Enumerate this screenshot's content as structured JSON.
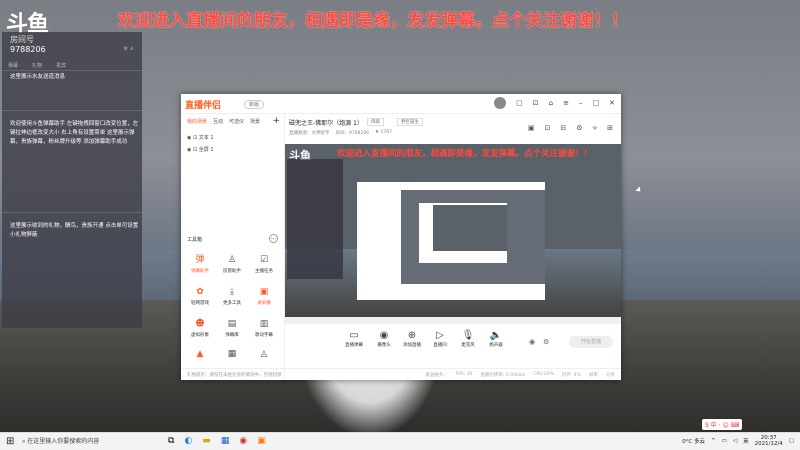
{
  "overlay": {
    "logo": "斗鱼",
    "marquee": "欢迎进入直播间的朋友，相遇即是缘，发发弹幕。点个关注谢谢！！"
  },
  "left_panel": {
    "room_label": "房间号",
    "room_id": "9788206",
    "tab_labels": [
      "弹幕",
      "礼物",
      "贵宾"
    ],
    "notice_1": "这里展示水友送道消息",
    "notice_2": "欢迎使用斗鱼弹幕助手 左键拖拽回窗口改变位置，左键拉伸边框改变大小 右上角有设置菜单 这里展示弹幕，贵族弹幕，粉丝牌升级等 添加弹幕助手成功",
    "notice_3": "这里展示收到的礼物，酬鸟，贵族开通 点击单可设置小礼物屏蔽"
  },
  "app": {
    "name": "直播伴侣",
    "version": "新版",
    "sidebar": {
      "tabs": [
        "我的场景",
        "互动",
        "可选仪",
        "场景"
      ],
      "add_label": "+",
      "items": [
        "文本 1",
        "全屏 1"
      ],
      "tools_title": "工具箱",
      "tools": [
        {
          "label": "弹幕助手",
          "icon": "弹"
        },
        {
          "label": "房管助手",
          "icon": "♙"
        },
        {
          "label": "主播任务",
          "icon": "☑"
        },
        {
          "label": "轻网游戏",
          "icon": "✿"
        },
        {
          "label": "更多工具",
          "icon": "⤓"
        },
        {
          "label": "录屏播",
          "icon": "▣"
        },
        {
          "label": "虚拟形象",
          "icon": "☻"
        },
        {
          "label": "弹幕库",
          "icon": "▤"
        },
        {
          "label": "歌词字幕",
          "icon": "▥"
        },
        {
          "label": "",
          "icon": "▲"
        },
        {
          "label": "",
          "icon": "▦"
        },
        {
          "label": "",
          "icon": "◬"
        }
      ]
    },
    "room": {
      "title": "磁兜之王-佛耶尔（炮源 1）",
      "chip_1": "佛耶",
      "chip_2": "野巨篇生",
      "sub": [
        "直播频道：大神捉字",
        "房间：9788206",
        "♦ 1797"
      ]
    },
    "preview": {
      "logo": "斗鱼",
      "marquee": "欢迎进入直播间的朋友，相遇即是缘，发发弹幕。点个关注谢谢！！"
    },
    "controls": [
      {
        "label": "直播弹幕",
        "icon": "▭"
      },
      {
        "label": "摄像头",
        "icon": "◉"
      },
      {
        "label": "添加直播",
        "icon": "⊕"
      },
      {
        "label": "直播间",
        "icon": "▷"
      },
      {
        "label": "麦克风",
        "icon": "🎙"
      },
      {
        "label": "扬声器",
        "icon": "🔈"
      }
    ],
    "live_button": "开始直播",
    "status_left": "礼物提示：请勿在未经允许的情况中，否则封禁",
    "status_right": [
      "发送服务：",
      "FPS: 30",
      "直播比特率: 0.00kb/s",
      "CPU:20%",
      "内存: 4%",
      "帧率",
      "分享"
    ]
  },
  "taskbar": {
    "search_placeholder": "在这里输入你要搜索的内容",
    "weather": "0°C 多云",
    "time": "20:37",
    "date": "2021/12/4",
    "ime": "英"
  }
}
